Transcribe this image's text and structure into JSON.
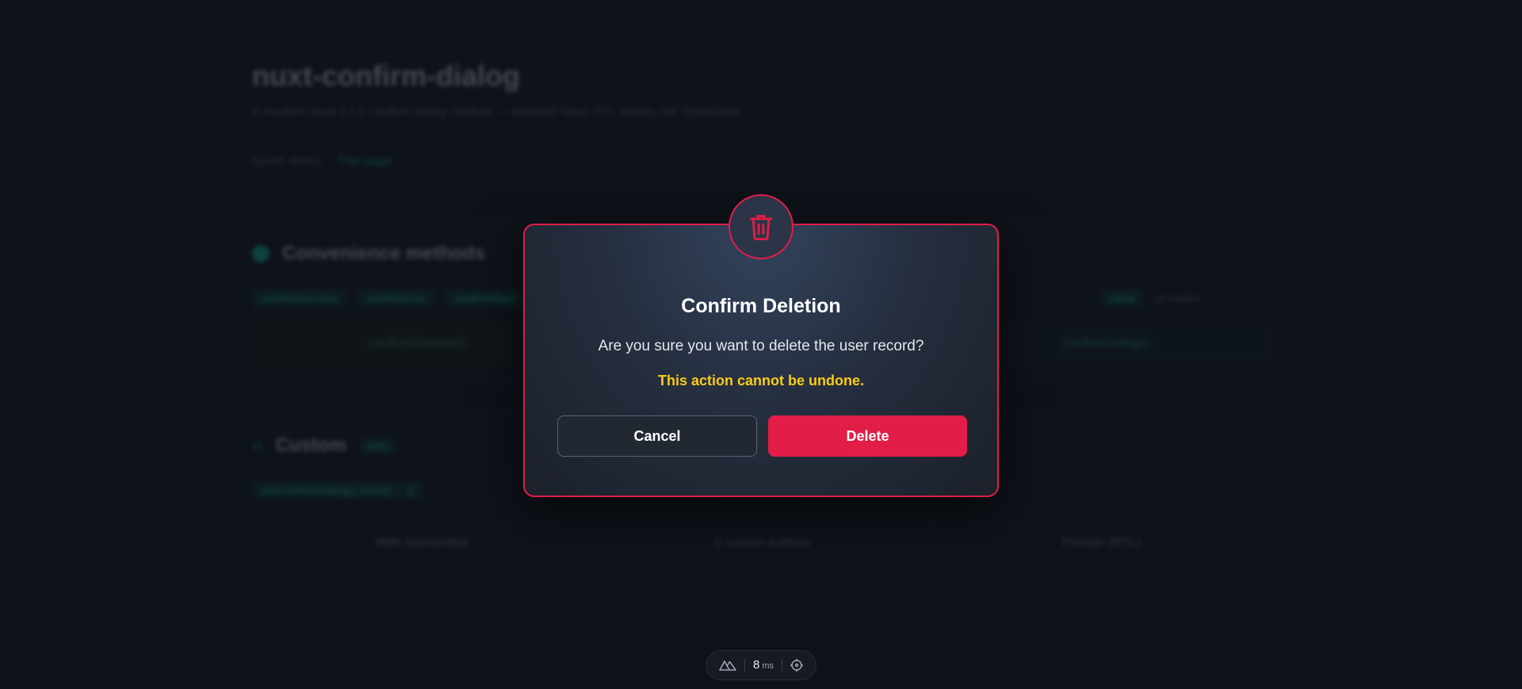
{
  "background": {
    "title": "nuxt-confirm-dialog",
    "subtitle": "A modern Nuxt 3 / 4 confirm dialog module — handled Vera, RTL aware, full TypeScript",
    "quick_demo_label": "Quick demo:",
    "quick_demo_link": "This page",
    "section_convenience": {
      "title": "Convenience methods",
      "tags": [
        "confirmSuccess",
        "confirmError",
        "confirmWarn"
      ],
      "tag_extra": "value",
      "tag_suffix": "of modes",
      "buttons": [
        "confirmSuccess()",
        "",
        "confirmDialog()"
      ]
    },
    "section_custom": {
      "title": "Custom",
      "badge": "slots",
      "hint": "useConfirmDialog().show({ ... })",
      "cells": [
        "With text/symbol",
        "3 custom buttons",
        "Persian (RTL)"
      ]
    }
  },
  "dialog": {
    "icon": "trash-icon",
    "title": "Confirm Deletion",
    "message": "Are you sure you want to delete the user record?",
    "warning": "This action cannot be undone.",
    "cancel_label": "Cancel",
    "confirm_label": "Delete",
    "accent_color": "#e11d48",
    "warning_color": "#facc15"
  },
  "devtools": {
    "logo": "nuxt-logo-icon",
    "render_time": "8",
    "render_unit": "ms",
    "inspector": "crosshair-icon"
  }
}
